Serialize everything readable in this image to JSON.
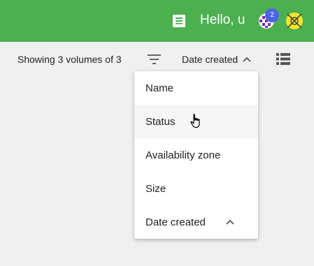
{
  "header": {
    "greeting": "Hello, u",
    "notification_count": "2",
    "notes_icon": "notes-icon",
    "avatar_icon": "avatar-icon",
    "org_icon": "organization-icon",
    "bar_color": "#4caf50",
    "badge_color": "#4b63e6"
  },
  "toolbar": {
    "count_text": "Showing 3 volumes of 3",
    "filter_icon": "filter-icon",
    "sort_label": "Date created",
    "sort_direction_icon": "chevron-up-icon",
    "view_icon": "list-view-icon"
  },
  "sort_menu": {
    "items": [
      {
        "label": "Name"
      },
      {
        "label": "Status"
      },
      {
        "label": "Availability zone"
      },
      {
        "label": "Size"
      },
      {
        "label": "Date created"
      }
    ],
    "hovered_item": "Status",
    "selected_item": "Date created"
  }
}
